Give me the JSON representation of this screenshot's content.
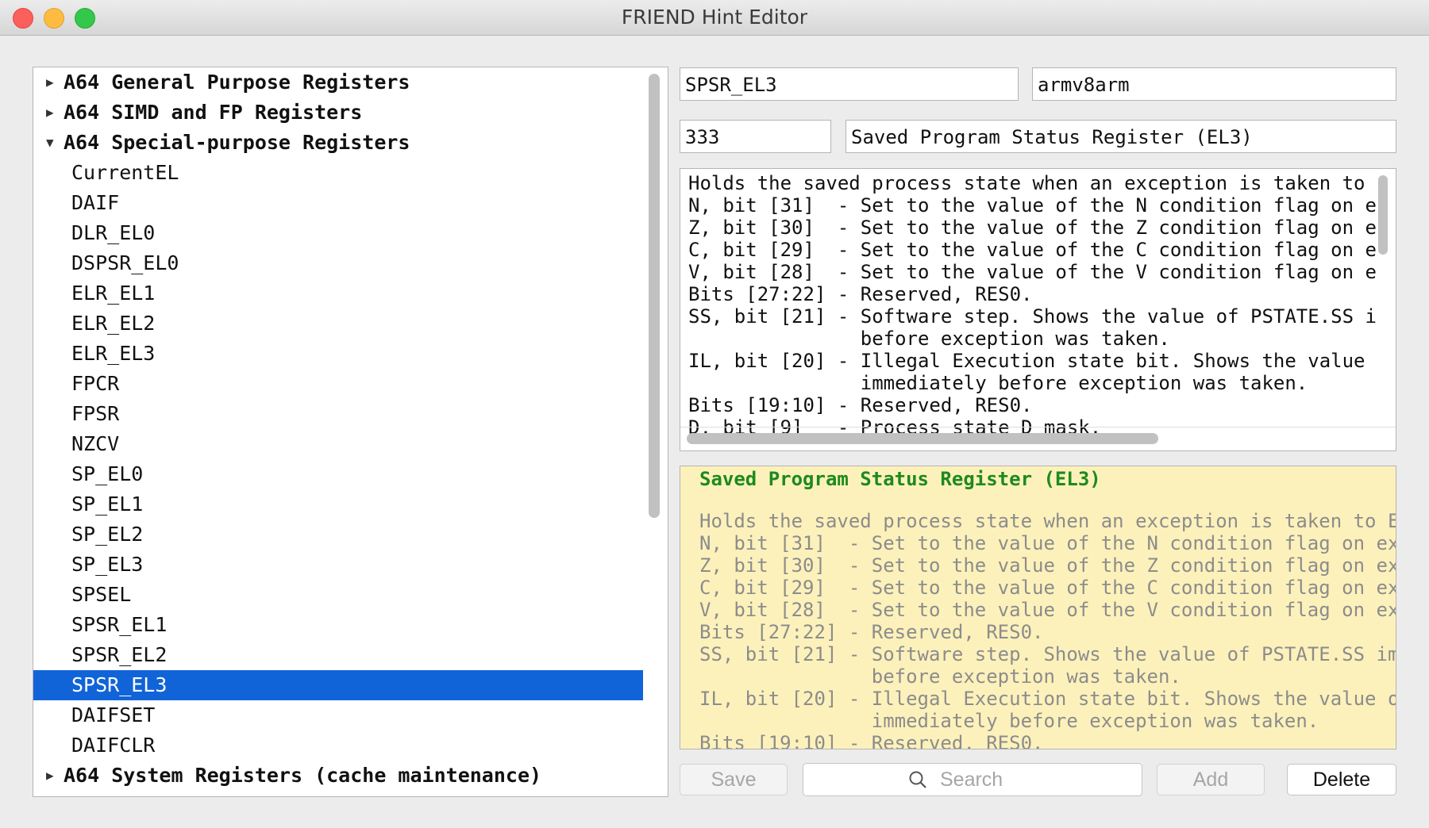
{
  "window": {
    "title": "FRIEND Hint Editor"
  },
  "tree": {
    "groups": [
      {
        "label": "A64 General Purpose Registers",
        "expanded": false
      },
      {
        "label": "A64 SIMD and FP Registers",
        "expanded": false
      },
      {
        "label": "A64 Special-purpose Registers",
        "expanded": true
      },
      {
        "label": "A64 System Registers (cache maintenance)",
        "expanded": false
      }
    ],
    "children": [
      "CurrentEL",
      "DAIF",
      "DLR_EL0",
      "DSPSR_EL0",
      "ELR_EL1",
      "ELR_EL2",
      "ELR_EL3",
      "FPCR",
      "FPSR",
      "NZCV",
      "SP_EL0",
      "SP_EL1",
      "SP_EL2",
      "SP_EL3",
      "SPSEL",
      "SPSR_EL1",
      "SPSR_EL2",
      "SPSR_EL3",
      "DAIFSET",
      "DAIFCLR"
    ],
    "selected": "SPSR_EL3",
    "icons": {
      "collapsed": "▶",
      "expanded": "▼"
    }
  },
  "form": {
    "name": "SPSR_EL3",
    "arch": "armv8arm",
    "id": "333",
    "description": "Saved Program Status Register (EL3)"
  },
  "editor": {
    "text": "Holds the saved process state when an exception is taken to \nN, bit [31]  - Set to the value of the N condition flag on e\nZ, bit [30]  - Set to the value of the Z condition flag on e\nC, bit [29]  - Set to the value of the C condition flag on e\nV, bit [28]  - Set to the value of the V condition flag on e\nBits [27:22] - Reserved, RES0.\nSS, bit [21] - Software step. Shows the value of PSTATE.SS i\n               before exception was taken.\nIL, bit [20] - Illegal Execution state bit. Shows the value\n               immediately before exception was taken.\nBits [19:10] - Reserved, RES0.\nD, bit [9]   - Process state D mask."
  },
  "preview": {
    "title": "Saved Program Status Register (EL3)",
    "text": "Holds the saved process state when an exception is taken to E\nN, bit [31]  - Set to the value of the N condition flag on ex\nZ, bit [30]  - Set to the value of the Z condition flag on ex\nC, bit [29]  - Set to the value of the C condition flag on ex\nV, bit [28]  - Set to the value of the V condition flag on ex\nBits [27:22] - Reserved, RES0.\nSS, bit [21] - Software step. Shows the value of PSTATE.SS im\n               before exception was taken.\nIL, bit [20] - Illegal Execution state bit. Shows the value o\n               immediately before exception was taken.\nBits [19:10] - Reserved, RES0.",
    "title_color": "#1d8a1d"
  },
  "buttons": {
    "save": "Save",
    "add": "Add",
    "delete": "Delete"
  },
  "search": {
    "placeholder": "Search"
  },
  "colors": {
    "selection": "#1064d8",
    "preview_bg": "#fdf1bb"
  }
}
